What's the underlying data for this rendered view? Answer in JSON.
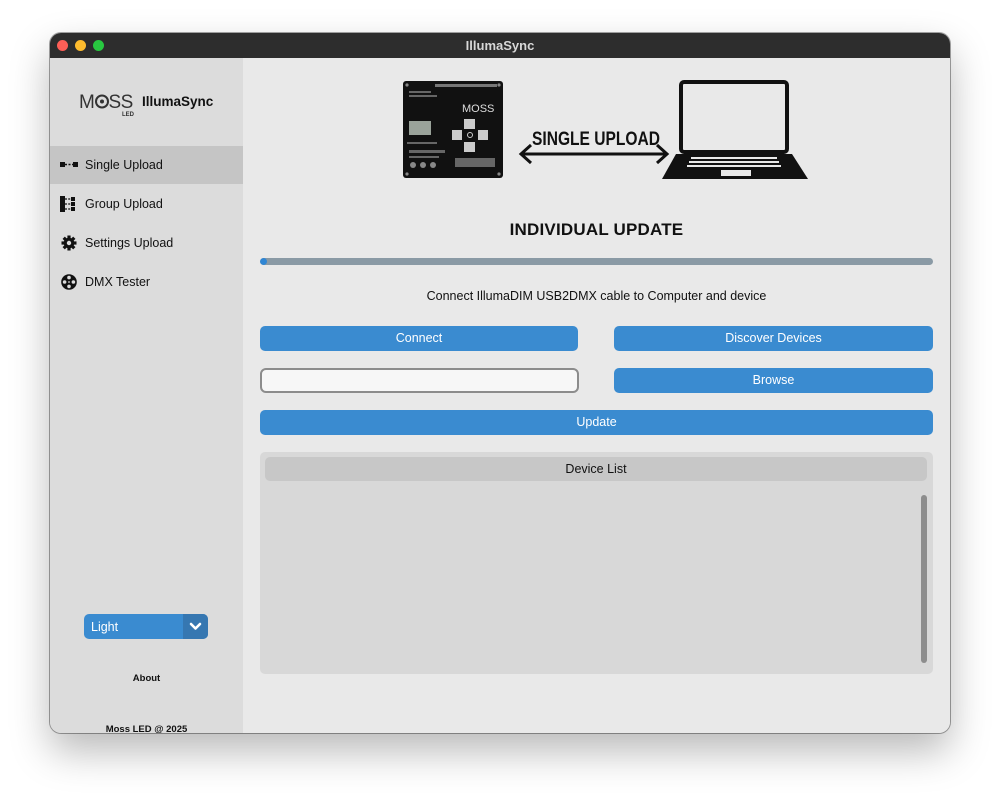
{
  "window": {
    "title": "IllumaSync",
    "traffic_lights": {
      "close": "#fe5f57",
      "minimize": "#febc2e",
      "zoom": "#28c840"
    }
  },
  "sidebar": {
    "brand": {
      "logo_icon": "moss-led-logo",
      "name": "IllumaSync"
    },
    "items": [
      {
        "label": "Single Upload",
        "icon": "single-upload-icon",
        "active": true
      },
      {
        "label": "Group Upload",
        "icon": "group-upload-icon",
        "active": false
      },
      {
        "label": "Settings Upload",
        "icon": "gear-icon",
        "active": false
      },
      {
        "label": "DMX Tester",
        "icon": "film-reel-icon",
        "active": false
      }
    ],
    "theme_select": {
      "value": "Light",
      "icon": "chevron-down-icon"
    },
    "about_label": "About",
    "footer": "Moss LED @ 2025"
  },
  "main": {
    "hero": {
      "arrow_label": "SINGLE UPLOAD",
      "device_icon": "dmx-decoder-device",
      "computer_icon": "laptop-icon"
    },
    "heading": "INDIVIDUAL UPDATE",
    "progress": {
      "value": 0.01
    },
    "instruction": "Connect IllumaDIM USB2DMX cable to Computer and device",
    "buttons": {
      "connect": "Connect",
      "discover": "Discover Devices",
      "browse": "Browse",
      "update": "Update"
    },
    "file_path": {
      "value": "",
      "placeholder": ""
    },
    "device_list": {
      "header": "Device List",
      "items": []
    }
  },
  "colors": {
    "accent": "#3a8bd0",
    "sidebar_bg": "#dcdcdc",
    "content_bg": "#e9e9e9",
    "titlebar_bg": "#2d2d2d"
  }
}
